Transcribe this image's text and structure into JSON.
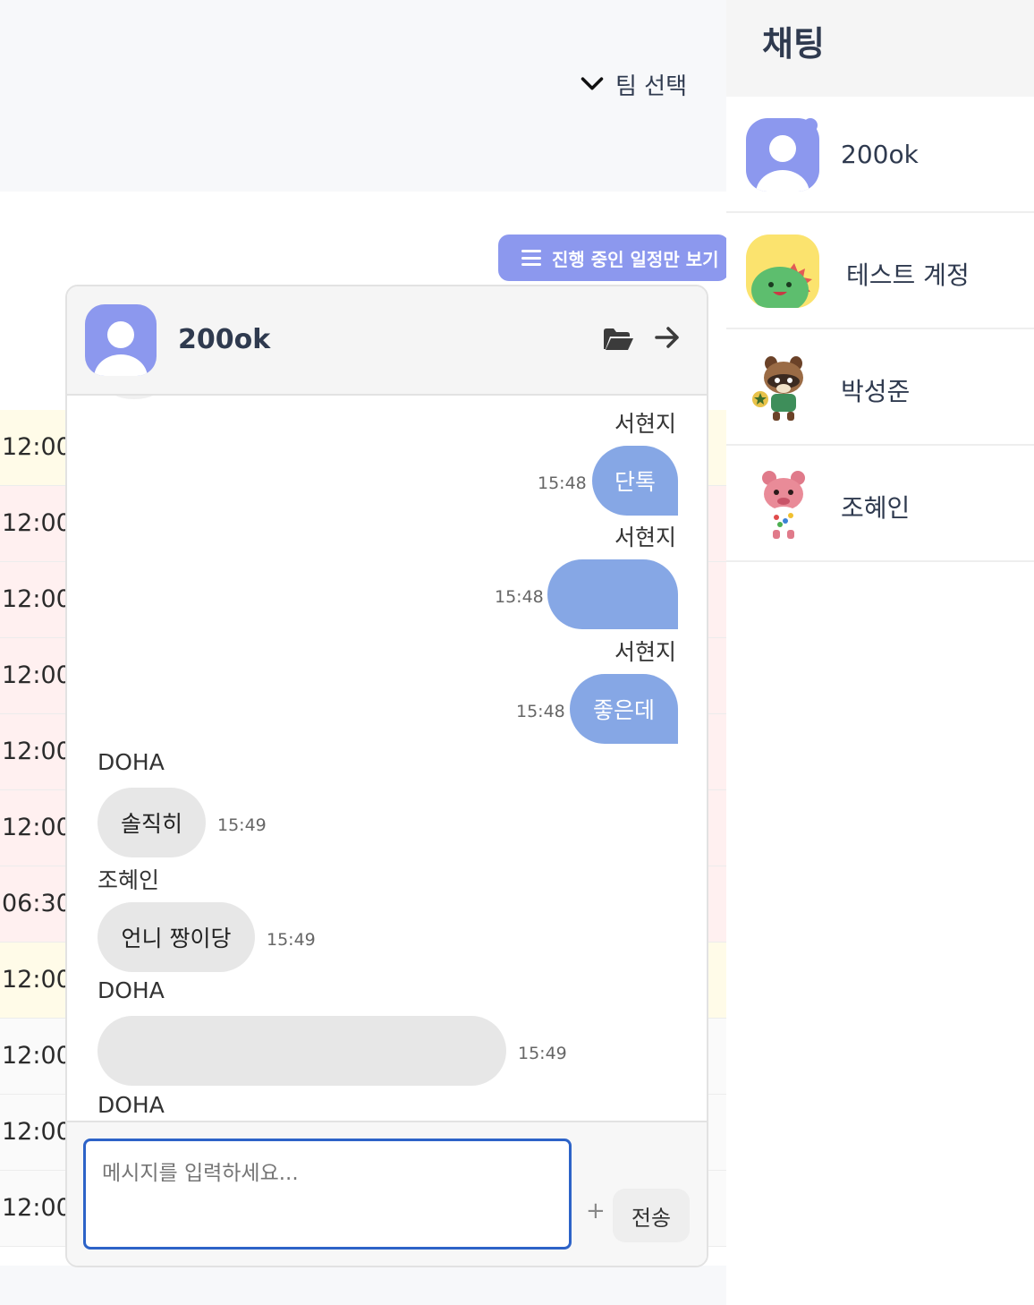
{
  "header": {
    "team_select_label": "팀 선택"
  },
  "schedule": {
    "filter_label": "진행 중인 일정만 보기",
    "times": [
      "12:00",
      "12:00",
      "12:00",
      "12:00",
      "12:00",
      "12:00",
      "06:30",
      "12:00",
      "12:00",
      "12:00",
      "12:00"
    ]
  },
  "chat_window": {
    "title": "200ok",
    "messages": [
      {
        "sender": "서현지",
        "text": "단톡",
        "time": "15:48"
      },
      {
        "sender": "서현지",
        "text": "",
        "time": "15:48"
      },
      {
        "sender": "서현지",
        "text": "좋은데",
        "time": "15:48"
      },
      {
        "sender": "DOHA",
        "text": "솔직히",
        "time": "15:49"
      },
      {
        "sender": "조혜인",
        "text": "언니 짱이당",
        "time": "15:49"
      },
      {
        "sender": "DOHA",
        "text": "",
        "time": "15:49"
      },
      {
        "sender": "DOHA"
      }
    ],
    "input_placeholder": "메시지를 입력하세요...",
    "plus_label": "+",
    "send_label": "전송"
  },
  "sidebar": {
    "title": "채팅",
    "rooms": [
      {
        "name": "200ok",
        "avatar": "default-user-icon"
      },
      {
        "name": "테스트 계정",
        "avatar": "green-dino-avatar"
      },
      {
        "name": "박성준",
        "avatar": "raccoon-avatar"
      },
      {
        "name": "조혜인",
        "avatar": "pink-bear-avatar"
      }
    ]
  },
  "colors": {
    "accent": "#8c98ee",
    "my_bubble": "#86a7e5",
    "other_bubble": "#e7e7e7",
    "input_border": "#2d63c8"
  }
}
